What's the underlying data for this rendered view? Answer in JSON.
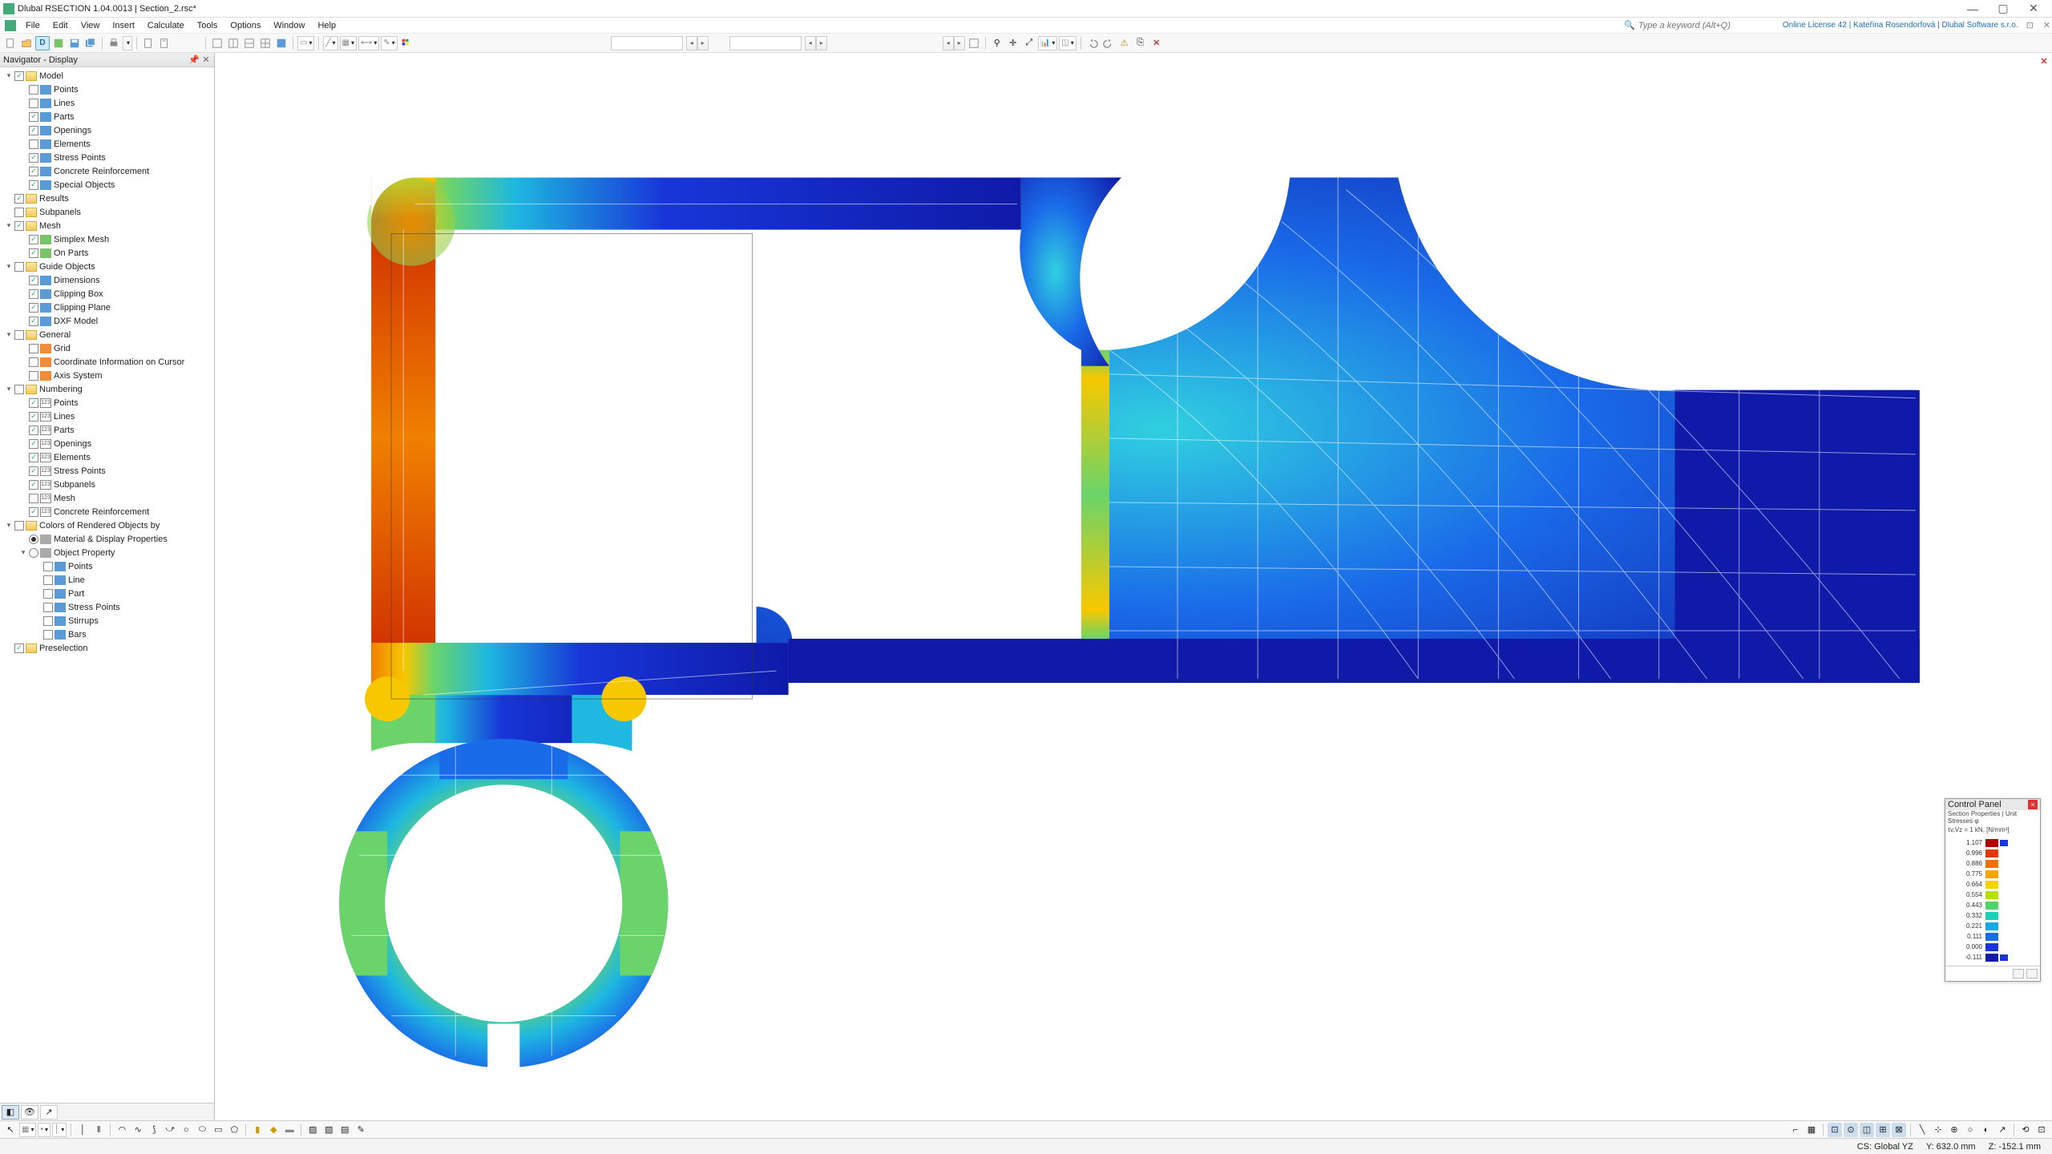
{
  "title": "Dlubal RSECTION 1.04.0013 | Section_2.rsc*",
  "menu": [
    "File",
    "Edit",
    "View",
    "Insert",
    "Calculate",
    "Tools",
    "Options",
    "Window",
    "Help"
  ],
  "search_placeholder": "Type a keyword (Alt+Q)",
  "license": "Online License 42 | Kateřina Rosendorfová | Dlubal Software s.r.o.",
  "navigator_title": "Navigator - Display",
  "tree": [
    {
      "d": 0,
      "exp": true,
      "chk": 2,
      "icon": "folder",
      "label": "Model"
    },
    {
      "d": 1,
      "exp": false,
      "chk": 0,
      "icon": "blue",
      "label": "Points"
    },
    {
      "d": 1,
      "exp": false,
      "chk": 0,
      "icon": "blue",
      "label": "Lines"
    },
    {
      "d": 1,
      "exp": false,
      "chk": 2,
      "icon": "blue",
      "label": "Parts"
    },
    {
      "d": 1,
      "exp": false,
      "chk": 2,
      "icon": "blue",
      "label": "Openings"
    },
    {
      "d": 1,
      "exp": false,
      "chk": 0,
      "icon": "blue",
      "label": "Elements"
    },
    {
      "d": 1,
      "exp": false,
      "chk": 2,
      "icon": "blue",
      "label": "Stress Points"
    },
    {
      "d": 1,
      "exp": false,
      "chk": 2,
      "icon": "blue",
      "label": "Concrete Reinforcement"
    },
    {
      "d": 1,
      "exp": false,
      "chk": 2,
      "icon": "blue",
      "label": "Special Objects"
    },
    {
      "d": 0,
      "exp": false,
      "chk": 2,
      "icon": "folder",
      "label": "Results"
    },
    {
      "d": 0,
      "exp": false,
      "chk": 0,
      "icon": "folder",
      "label": "Subpanels"
    },
    {
      "d": 0,
      "exp": true,
      "chk": 2,
      "icon": "folder",
      "label": "Mesh"
    },
    {
      "d": 1,
      "exp": false,
      "chk": 2,
      "icon": "green",
      "label": "Simplex Mesh"
    },
    {
      "d": 1,
      "exp": false,
      "chk": 2,
      "icon": "green",
      "label": "On Parts"
    },
    {
      "d": 0,
      "exp": true,
      "chk": 0,
      "icon": "folder",
      "label": "Guide Objects"
    },
    {
      "d": 1,
      "exp": false,
      "chk": 2,
      "icon": "blue",
      "label": "Dimensions"
    },
    {
      "d": 1,
      "exp": false,
      "chk": 2,
      "icon": "blue",
      "label": "Clipping Box"
    },
    {
      "d": 1,
      "exp": false,
      "chk": 2,
      "icon": "blue",
      "label": "Clipping Plane"
    },
    {
      "d": 1,
      "exp": false,
      "chk": 2,
      "icon": "blue",
      "label": "DXF Model"
    },
    {
      "d": 0,
      "exp": true,
      "chk": 0,
      "icon": "folder",
      "label": "General"
    },
    {
      "d": 1,
      "exp": false,
      "chk": 0,
      "icon": "orange",
      "label": "Grid"
    },
    {
      "d": 1,
      "exp": false,
      "chk": 0,
      "icon": "orange",
      "label": "Coordinate Information on Cursor"
    },
    {
      "d": 1,
      "exp": false,
      "chk": 0,
      "icon": "orange",
      "label": "Axis System"
    },
    {
      "d": 0,
      "exp": true,
      "chk": 0,
      "icon": "folder",
      "label": "Numbering"
    },
    {
      "d": 1,
      "exp": false,
      "chk": 2,
      "icon": "num",
      "label": "Points"
    },
    {
      "d": 1,
      "exp": false,
      "chk": 2,
      "icon": "num",
      "label": "Lines"
    },
    {
      "d": 1,
      "exp": false,
      "chk": 2,
      "icon": "num",
      "label": "Parts"
    },
    {
      "d": 1,
      "exp": false,
      "chk": 2,
      "icon": "num",
      "label": "Openings"
    },
    {
      "d": 1,
      "exp": false,
      "chk": 2,
      "icon": "num",
      "label": "Elements"
    },
    {
      "d": 1,
      "exp": false,
      "chk": 2,
      "icon": "num",
      "label": "Stress Points"
    },
    {
      "d": 1,
      "exp": false,
      "chk": 2,
      "icon": "num",
      "label": "Subpanels"
    },
    {
      "d": 1,
      "exp": false,
      "chk": 0,
      "icon": "num",
      "label": "Mesh"
    },
    {
      "d": 1,
      "exp": false,
      "chk": 2,
      "icon": "num",
      "label": "Concrete Reinforcement"
    },
    {
      "d": 0,
      "exp": true,
      "chk": 0,
      "icon": "folder",
      "label": "Colors of Rendered Objects by"
    },
    {
      "d": 1,
      "exp": false,
      "rad": true,
      "icon": "gray",
      "label": "Material & Display Properties"
    },
    {
      "d": 1,
      "exp": true,
      "rad": false,
      "icon": "gray",
      "label": "Object Property"
    },
    {
      "d": 2,
      "exp": false,
      "chk": 0,
      "icon": "blue",
      "label": "Points"
    },
    {
      "d": 2,
      "exp": false,
      "chk": 0,
      "icon": "blue",
      "label": "Line"
    },
    {
      "d": 2,
      "exp": false,
      "chk": 0,
      "icon": "blue",
      "label": "Part"
    },
    {
      "d": 2,
      "exp": false,
      "chk": 0,
      "icon": "blue",
      "label": "Stress Points"
    },
    {
      "d": 2,
      "exp": false,
      "chk": 0,
      "icon": "blue",
      "label": "Stirrups"
    },
    {
      "d": 2,
      "exp": false,
      "chk": 0,
      "icon": "blue",
      "label": "Bars"
    },
    {
      "d": 0,
      "exp": false,
      "chk": 2,
      "icon": "folder",
      "label": "Preselection"
    }
  ],
  "control_panel": {
    "title": "Control Panel",
    "subtitle1": "Section Properties | Unit Stresses φ",
    "subtitle2": "τv,Vz = 1 kN, [N/mm²]",
    "scale": [
      {
        "v": "1.107",
        "c": "#b30000"
      },
      {
        "v": "0.996",
        "c": "#e03a00"
      },
      {
        "v": "0.886",
        "c": "#f07000"
      },
      {
        "v": "0.775",
        "c": "#f7a400"
      },
      {
        "v": "0.664",
        "c": "#f5d400"
      },
      {
        "v": "0.554",
        "c": "#b6e000"
      },
      {
        "v": "0.443",
        "c": "#4fd46a"
      },
      {
        "v": "0.332",
        "c": "#19d0b8"
      },
      {
        "v": "0.221",
        "c": "#17a8e8"
      },
      {
        "v": "0.111",
        "c": "#1a6be8"
      },
      {
        "v": "0.000",
        "c": "#1836d8"
      },
      {
        "v": "-0.111",
        "c": "#0f1aa8"
      }
    ]
  },
  "status": {
    "cs": "CS: Global YZ",
    "y": "Y: 632.0 mm",
    "z": "Z: -152.1 mm"
  }
}
